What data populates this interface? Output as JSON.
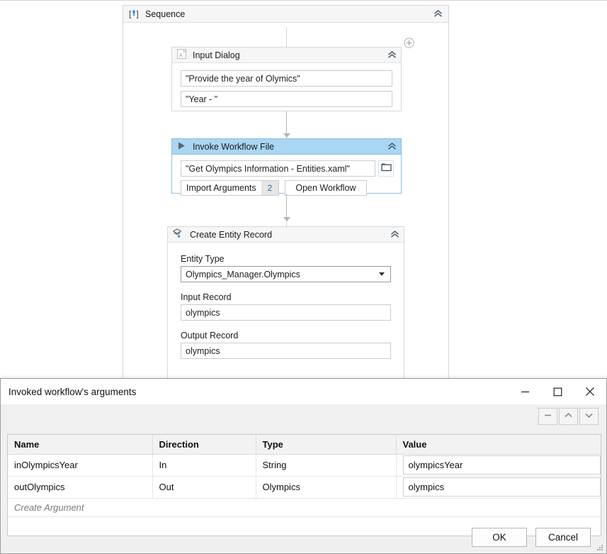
{
  "canvas": {
    "sequence": {
      "title": "Sequence",
      "icon": "sequence-icon",
      "collapse_icon": "chevron-up-icon",
      "add_icon": "plus-circle-icon"
    },
    "activities": [
      {
        "title": "Input Dialog",
        "icon": "input-dialog-icon",
        "collapse_icon": "chevron-up-icon",
        "fields": [
          {
            "value": "\"Provide the year of Olymics\""
          },
          {
            "value": "\"Year - \""
          }
        ]
      },
      {
        "title": "Invoke Workflow File",
        "icon": "play-triangle-icon",
        "collapse_icon": "chevron-up-icon",
        "path_value": "\"Get Olympics Information - Entities.xaml\"",
        "browse_icon": "folder-icon",
        "import_arguments_label": "Import Arguments",
        "import_arguments_count": "2",
        "open_workflow_label": "Open Workflow"
      },
      {
        "title": "Create Entity Record",
        "icon": "create-entity-icon",
        "collapse_icon": "chevron-up-icon",
        "entity_type_label": "Entity Type",
        "entity_type_value": "Olympics_Manager.Olympics",
        "input_record_label": "Input Record",
        "input_record_value": "olympics",
        "output_record_label": "Output Record",
        "output_record_value": "olympics"
      }
    ]
  },
  "dialog": {
    "title": "Invoked workflow's arguments",
    "window_controls": [
      {
        "name": "minimize-button",
        "glyph": "─"
      },
      {
        "name": "maximize-button",
        "glyph": "☐"
      },
      {
        "name": "close-button",
        "glyph": "✕"
      }
    ],
    "toolbar": [
      {
        "name": "remove-argument-button",
        "icon": "minus-icon"
      },
      {
        "name": "move-up-button",
        "icon": "chevron-up-icon"
      },
      {
        "name": "move-down-button",
        "icon": "chevron-down-icon"
      }
    ],
    "table": {
      "columns": [
        "Name",
        "Direction",
        "Type",
        "Value"
      ],
      "rows": [
        {
          "name": "inOlympicsYear",
          "direction": "In",
          "type": "String",
          "value": "olympicsYear"
        },
        {
          "name": "outOlympics",
          "direction": "Out",
          "type": "Olympics",
          "value": "olympics"
        }
      ],
      "create_row_label": "Create Argument"
    },
    "buttons": {
      "ok": "OK",
      "cancel": "Cancel"
    }
  },
  "colors": {
    "accent_blue": "#a9d6f2",
    "accent_border": "#8cc0e4",
    "badge_text": "#2a6fa8",
    "canvas_bg": "#ffffff",
    "dialog_bg": "#f0f0f0"
  }
}
